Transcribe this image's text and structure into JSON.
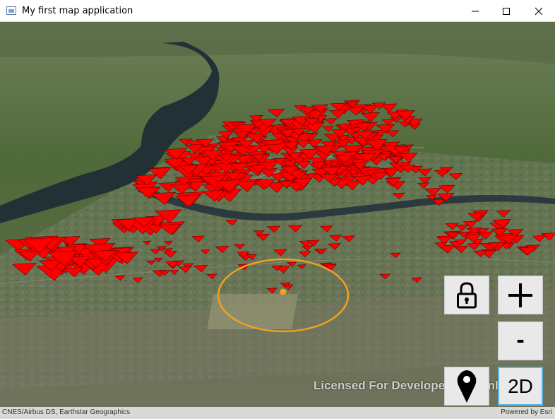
{
  "window": {
    "title": "My first map application"
  },
  "map": {
    "view_mode": "3D",
    "basemap": "imagery",
    "marker_color": "#ff0000",
    "selection_ring_color": "#f0a020",
    "selection_point_color": "#f7a21b",
    "watermark": "Licensed For Developer Use Only",
    "attribution": "CNES/Airbus DS, Earthstar Geographics",
    "powered_by": "Powered by Esri"
  },
  "controls": {
    "lock_icon": "lock-icon",
    "zoom_in": "+",
    "zoom_out": "-",
    "location_icon": "map-pin-icon",
    "toggle_view": "2D"
  }
}
